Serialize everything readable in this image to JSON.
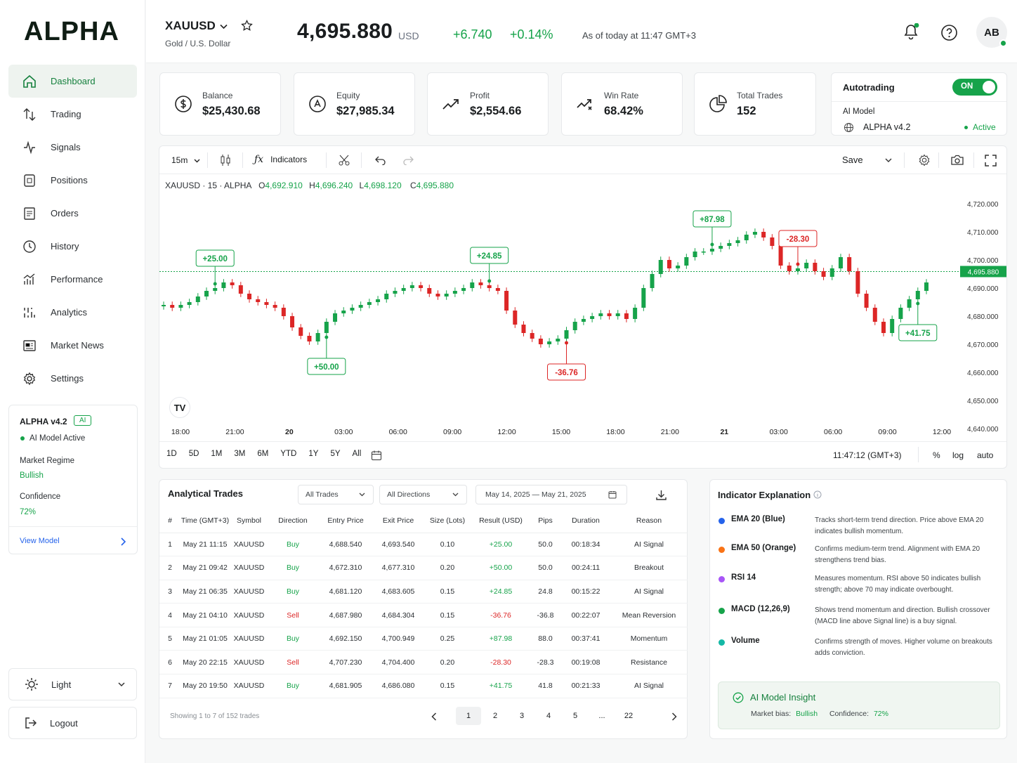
{
  "app": {
    "logo": "ALPHA"
  },
  "nav": [
    {
      "label": "Dashboard",
      "icon": "home-icon"
    },
    {
      "label": "Trading",
      "icon": "arrows-icon"
    },
    {
      "label": "Signals",
      "icon": "signal-icon"
    },
    {
      "label": "Positions",
      "icon": "positions-icon"
    },
    {
      "label": "Orders",
      "icon": "orders-icon"
    },
    {
      "label": "History",
      "icon": "clock-icon"
    },
    {
      "label": "Performance",
      "icon": "performance-icon"
    },
    {
      "label": "Analytics",
      "icon": "analytics-icon"
    },
    {
      "label": "Market News",
      "icon": "news-icon"
    },
    {
      "label": "Settings",
      "icon": "gear-icon"
    }
  ],
  "model": {
    "name": "ALPHA v4.2",
    "badge": "AI",
    "status": "AI Model Active",
    "regime_label": "Market Regime",
    "regime": "Bullish",
    "confidence_label": "Confidence",
    "confidence": "72%",
    "view": "View Model"
  },
  "theme": {
    "label": "Light"
  },
  "logout": {
    "label": "Logout"
  },
  "header": {
    "symbol": "XAUUSD",
    "name": "Gold / U.S. Dollar",
    "price": "4,695.880",
    "currency": "USD",
    "change": "+6.740",
    "change_pct": "+0.14%",
    "asof": "As of today at 11:47 GMT+3",
    "avatar": "AB"
  },
  "stats": [
    {
      "label": "Balance",
      "value": "$25,430.68",
      "icon": "dollar-icon"
    },
    {
      "label": "Equity",
      "value": "$27,985.34",
      "icon": "equity-icon"
    },
    {
      "label": "Profit",
      "value": "$2,554.66",
      "icon": "trend-up-icon"
    },
    {
      "label": "Win Rate",
      "value": "68.42%",
      "icon": "winrate-icon"
    },
    {
      "label": "Total Trades",
      "value": "152",
      "icon": "pie-icon"
    }
  ],
  "autotrading": {
    "label": "Autotrading",
    "toggle": "ON",
    "model_label": "AI Model",
    "model": "ALPHA v4.2",
    "status": "Active"
  },
  "toolbar": {
    "interval": "15m",
    "indicators": "Indicators",
    "save": "Save"
  },
  "ohlc": {
    "title": "XAUUSD · 15 · ALPHA",
    "o_label": "O",
    "o": "4,692.910",
    "h_label": "H",
    "h": "4,696.240",
    "l_label": "L",
    "l": "4,698.120",
    "c_label": "C",
    "c": "4,695.880"
  },
  "chart_data": {
    "type": "candlestick",
    "ylim": [
      4640,
      4720
    ],
    "yticks": [
      "4,720.000",
      "4,710.000",
      "4,700.000",
      "4,690.000",
      "4,680.000",
      "4,670.000",
      "4,660.000",
      "4,650.000",
      "4,640.000"
    ],
    "xticks": [
      "18:00",
      "21:00",
      "20",
      "03:00",
      "06:00",
      "09:00",
      "12:00",
      "15:00",
      "18:00",
      "21:00",
      "21",
      "03:00",
      "06:00",
      "09:00",
      "12:00"
    ],
    "last_price": "4,695.880",
    "close": [
      4684,
      4683,
      4684,
      4685,
      4687,
      4689,
      4690,
      4692,
      4691,
      4688,
      4686,
      4685,
      4684,
      4683,
      4680,
      4676,
      4673,
      4671,
      4674,
      4678,
      4681,
      4682,
      4683,
      4684,
      4685,
      4686,
      4688,
      4689,
      4690,
      4691,
      4690,
      4688,
      4687,
      4688,
      4689,
      4690,
      4692,
      4691,
      4690,
      4689,
      4682,
      4677,
      4674,
      4672,
      4670,
      4671,
      4672,
      4675,
      4678,
      4679,
      4680,
      4681,
      4680,
      4681,
      4679,
      4683,
      4690,
      4695,
      4700,
      4697,
      4698,
      4701,
      4703,
      4703,
      4704,
      4705,
      4706,
      4707,
      4709,
      4710,
      4708,
      4705,
      4698,
      4696,
      4697,
      4699,
      4696,
      4694,
      4697,
      4701,
      4696,
      4688,
      4683,
      4678,
      4674,
      4679,
      4683,
      4686,
      4689,
      4692
    ],
    "annotations": [
      {
        "label": "+25.00",
        "type": "buy",
        "pos": "above"
      },
      {
        "label": "+50.00",
        "type": "buy",
        "pos": "below"
      },
      {
        "label": "+24.85",
        "type": "buy",
        "pos": "above"
      },
      {
        "label": "-36.76",
        "type": "sell",
        "pos": "below"
      },
      {
        "label": "+87.98",
        "type": "buy",
        "pos": "above"
      },
      {
        "label": "-28.30",
        "type": "sell",
        "pos": "above"
      },
      {
        "label": "+41.75",
        "type": "buy",
        "pos": "below"
      }
    ]
  },
  "ranges": [
    "1D",
    "5D",
    "1M",
    "3M",
    "6M",
    "YTD",
    "1Y",
    "5Y",
    "All"
  ],
  "chart_footer": {
    "time": "11:47:12 (GMT+3)",
    "pct": "%",
    "log": "log",
    "auto": "auto"
  },
  "trades": {
    "title": "Analytical Trades",
    "filter_trades": "All Trades",
    "filter_dir": "All Directions",
    "date_range": "May 14, 2025  —  May 21, 2025",
    "columns": [
      "#",
      "Time (GMT+3)",
      "Symbol",
      "Direction",
      "Entry Price",
      "Exit Price",
      "Size (Lots)",
      "Result (USD)",
      "Pips",
      "Duration",
      "Reason"
    ],
    "rows": [
      [
        "1",
        "May 21 11:15",
        "XAUUSD",
        "Buy",
        "4,688.540",
        "4,693.540",
        "0.10",
        "+25.00",
        "50.0",
        "00:18:34",
        "AI Signal"
      ],
      [
        "2",
        "May 21 09:42",
        "XAUUSD",
        "Buy",
        "4,672.310",
        "4,677.310",
        "0.20",
        "+50.00",
        "50.0",
        "00:24:11",
        "Breakout"
      ],
      [
        "3",
        "May 21 06:35",
        "XAUUSD",
        "Buy",
        "4,681.120",
        "4,683.605",
        "0.15",
        "+24.85",
        "24.8",
        "00:15:22",
        "AI Signal"
      ],
      [
        "4",
        "May 21 04:10",
        "XAUUSD",
        "Sell",
        "4,687.980",
        "4,684.304",
        "0.15",
        "-36.76",
        "-36.8",
        "00:22:07",
        "Mean Reversion"
      ],
      [
        "5",
        "May 21 01:05",
        "XAUUSD",
        "Buy",
        "4,692.150",
        "4,700.949",
        "0.25",
        "+87.98",
        "88.0",
        "00:37:41",
        "Momentum"
      ],
      [
        "6",
        "May 20 22:15",
        "XAUUSD",
        "Sell",
        "4,707.230",
        "4,704.400",
        "0.20",
        "-28.30",
        "-28.3",
        "00:19:08",
        "Resistance"
      ],
      [
        "7",
        "May 20 19:50",
        "XAUUSD",
        "Buy",
        "4,681.905",
        "4,686.080",
        "0.15",
        "+41.75",
        "41.8",
        "00:21:33",
        "AI Signal"
      ]
    ],
    "showing": "Showing 1 to 7 of 152 trades",
    "pages": [
      "1",
      "2",
      "3",
      "4",
      "5",
      "...",
      "22"
    ]
  },
  "indicators": {
    "title": "Indicator Explanation",
    "items": [
      {
        "name": "EMA 20 (Blue)",
        "color": "#2563eb",
        "desc": "Tracks short-term trend direction. Price above EMA 20 indicates bullish momentum."
      },
      {
        "name": "EMA 50 (Orange)",
        "color": "#f97316",
        "desc": "Confirms medium-term trend. Alignment with EMA 20 strengthens trend bias."
      },
      {
        "name": "RSI 14",
        "color": "#a855f7",
        "desc": "Measures momentum. RSI above 50 indicates bullish strength; above 70 may indicate overbought."
      },
      {
        "name": "MACD (12,26,9)",
        "color": "#16a34a",
        "desc": "Shows trend momentum and direction. Bullish crossover (MACD line above Signal line) is a buy signal."
      },
      {
        "name": "Volume",
        "color": "#14b8a6",
        "desc": "Confirms strength of moves. Higher volume on breakouts adds conviction."
      }
    ],
    "insight_title": "AI Model Insight",
    "bias_label": "Market bias:",
    "bias": "Bullish",
    "conf_label": "Confidence:",
    "conf": "72%"
  }
}
